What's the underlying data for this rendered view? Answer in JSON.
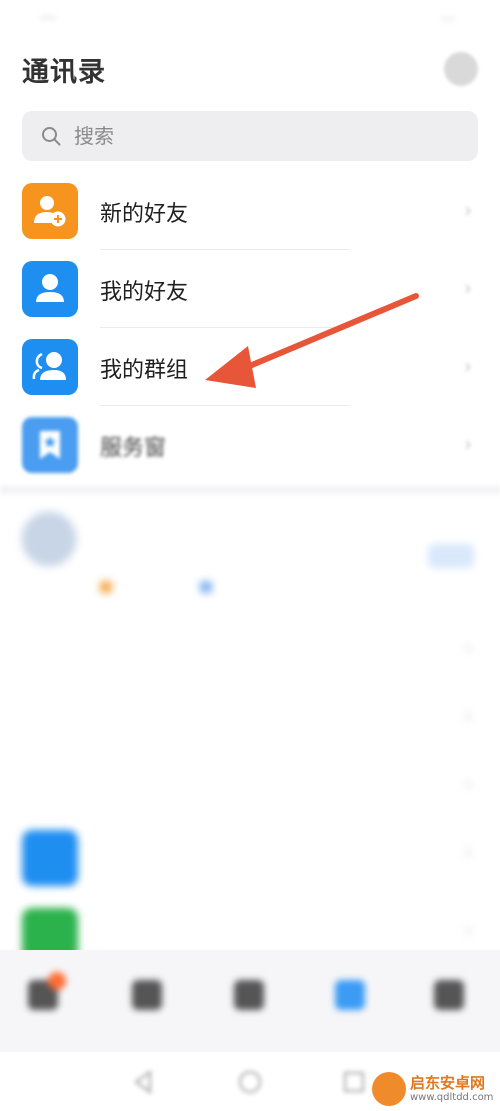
{
  "status_bar": {
    "left_text": "...",
    "right_text": "..."
  },
  "header": {
    "title": "通讯录"
  },
  "search": {
    "placeholder": "搜索"
  },
  "menu": {
    "items": [
      {
        "label": "新的好友",
        "icon": "add-friend-icon",
        "color": "#f7941d"
      },
      {
        "label": "我的好友",
        "icon": "person-icon",
        "color": "#1f8ef1"
      },
      {
        "label": "我的群组",
        "icon": "group-icon",
        "color": "#1f8ef1"
      },
      {
        "label": "服务窗",
        "icon": "bookmark-star-icon",
        "color": "#4a9df0"
      }
    ],
    "arrow": "›"
  },
  "org": {
    "name": "",
    "tag1": "",
    "tag2": "",
    "enter_label": "",
    "sub_rows": [
      {
        "label": ""
      },
      {
        "label": ""
      },
      {
        "label": "",
        "note": ""
      }
    ]
  },
  "more_items": [
    {
      "label": "",
      "color": "#1f8ef1"
    },
    {
      "label": "",
      "color": "#2bb24c"
    }
  ],
  "tabs": [
    {
      "label": "",
      "icon": "message-icon",
      "badge": true
    },
    {
      "label": "",
      "icon": "home-icon"
    },
    {
      "label": "",
      "icon": "workbench-icon"
    },
    {
      "label": "",
      "icon": "contacts-icon",
      "active": true,
      "color": "#3b9bf5"
    },
    {
      "label": "",
      "icon": "me-icon"
    }
  ],
  "watermark": {
    "title": "启东安卓网",
    "url": "www.qdltdd.com"
  },
  "colors": {
    "annotation_arrow": "#e8563a"
  }
}
